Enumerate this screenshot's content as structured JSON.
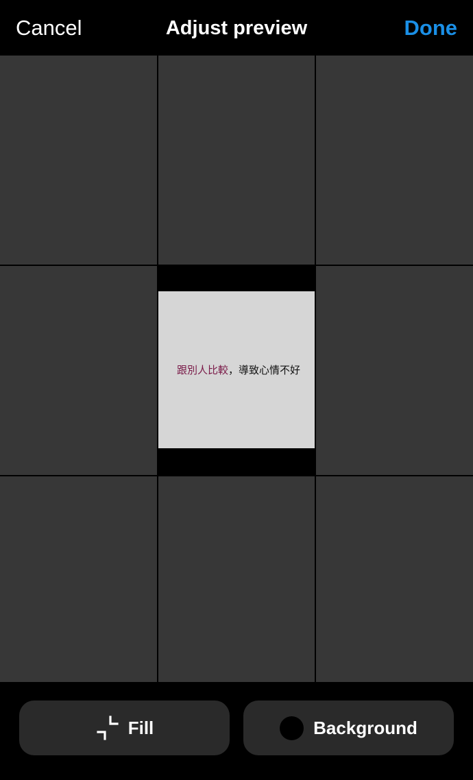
{
  "header": {
    "cancel_label": "Cancel",
    "title": "Adjust preview",
    "done_label": "Done"
  },
  "preview": {
    "caption_highlight": "跟別人比較",
    "caption_rest": "，導致心情不好"
  },
  "toolbar": {
    "fill_label": "Fill",
    "background_label": "Background",
    "background_color": "#000000"
  },
  "colors": {
    "accent": "#1a8fe6",
    "cell": "#373737",
    "button": "#2a2a2a",
    "caption_highlight": "#7a1a48"
  }
}
